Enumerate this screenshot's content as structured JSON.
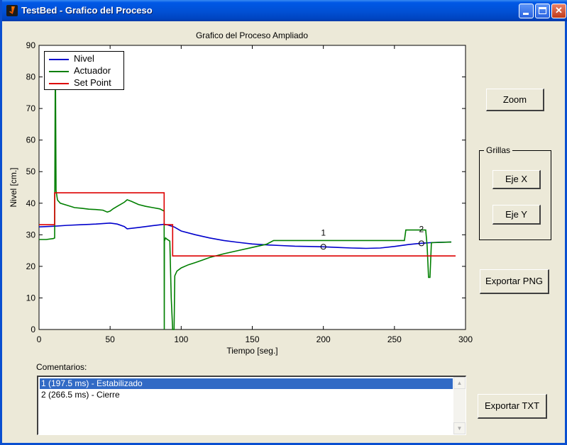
{
  "window": {
    "title": "TestBed - Grafico del Proceso",
    "controls": {
      "minimize": "minimize",
      "maximize": "maximize",
      "close": "✕"
    }
  },
  "colors": {
    "nivel": "#0000cc",
    "actuador": "#007f00",
    "setpoint": "#dd0000",
    "selection": "#316ac5"
  },
  "plot": {
    "title": "Grafico del Proceso Ampliado",
    "xlabel": "Tiempo [seg.]",
    "ylabel": "Nivel [cm.]",
    "xticks": [
      "0",
      "50",
      "100",
      "150",
      "200",
      "250",
      "300"
    ],
    "yticks": [
      "0",
      "10",
      "20",
      "30",
      "40",
      "50",
      "60",
      "70",
      "80",
      "90"
    ],
    "legend": [
      "Nivel",
      "Actuador",
      "Set Point"
    ],
    "markers": [
      {
        "label": "1",
        "symbol": "o"
      },
      {
        "label": "2",
        "symbol": "o"
      }
    ]
  },
  "chart_data": {
    "type": "line",
    "title": "Grafico del Proceso Ampliado",
    "xlabel": "Tiempo [seg.]",
    "ylabel": "Nivel [cm.]",
    "xlim": [
      0,
      300
    ],
    "ylim": [
      0,
      90
    ],
    "grid": false,
    "legend_position": "top-left",
    "series": [
      {
        "name": "Nivel",
        "color": "#0000cc",
        "x": [
          0,
          10,
          20,
          30,
          40,
          50,
          55,
          60,
          62,
          70,
          80,
          88,
          90,
          95,
          100,
          110,
          120,
          130,
          140,
          150,
          160,
          170,
          180,
          190,
          200,
          210,
          220,
          230,
          240,
          250,
          260,
          268,
          272,
          275,
          280,
          290
        ],
        "y": [
          32.5,
          32.7,
          33.0,
          33.2,
          33.4,
          33.7,
          33.4,
          32.6,
          31.9,
          32.3,
          32.9,
          33.3,
          33.2,
          32.5,
          31.2,
          30.0,
          29.0,
          28.2,
          27.6,
          27.1,
          26.8,
          26.6,
          26.4,
          26.3,
          26.2,
          26.0,
          25.8,
          25.7,
          25.8,
          26.3,
          26.9,
          27.3,
          27.4,
          27.5,
          27.6,
          27.7
        ]
      },
      {
        "name": "Actuador",
        "color": "#007f00",
        "x": [
          0,
          5,
          10,
          11,
          11.5,
          12,
          13,
          15,
          20,
          25,
          30,
          35,
          40,
          45,
          48,
          50,
          52,
          55,
          60,
          62,
          65,
          70,
          75,
          80,
          85,
          88,
          88.1,
          88.2,
          89,
          90,
          92,
          93,
          94,
          95,
          95.5,
          97,
          100,
          105,
          110,
          115,
          120,
          130,
          140,
          150,
          160,
          165,
          170,
          180,
          200,
          220,
          240,
          257,
          258,
          270,
          272,
          273,
          274,
          275,
          276,
          290
        ],
        "y": [
          28.5,
          28.5,
          28.8,
          29,
          88,
          44,
          41,
          40,
          39.3,
          38.6,
          38.4,
          38.1,
          38.0,
          37.8,
          37.2,
          37.5,
          38.2,
          39.0,
          40.3,
          41.1,
          40.6,
          39.6,
          39.0,
          38.6,
          38.2,
          37.5,
          0,
          28,
          29,
          28.6,
          28,
          10,
          0,
          0,
          17,
          18.5,
          19.5,
          20.5,
          21.2,
          22.0,
          22.8,
          24,
          25,
          26,
          27,
          28.2,
          28.2,
          28.2,
          28.2,
          28.2,
          28.2,
          28.2,
          31.5,
          31.5,
          31.5,
          26.5,
          16.5,
          16.5,
          27.5,
          27.7
        ]
      },
      {
        "name": "Set Point",
        "color": "#dd0000",
        "x": [
          0,
          11,
          11,
          88,
          88,
          94,
          94,
          293
        ],
        "y": [
          33.2,
          33.2,
          43.3,
          43.3,
          33.2,
          33.2,
          23.3,
          23.3
        ]
      }
    ],
    "annotations": [
      {
        "label": "1",
        "x": 200,
        "y": 26.2
      },
      {
        "label": "2",
        "x": 269,
        "y": 27.3
      }
    ]
  },
  "buttons": {
    "zoom": "Zoom",
    "eje_x": "Eje X",
    "eje_y": "Eje Y",
    "export_png": "Exportar PNG",
    "export_txt": "Exportar TXT"
  },
  "grillas": {
    "label": "Grillas"
  },
  "comments": {
    "label": "Comentarios:",
    "items": [
      "1 (197.5 ms) - Estabilizado",
      "2 (266.5 ms) - Cierre"
    ],
    "selected_index": 0
  }
}
